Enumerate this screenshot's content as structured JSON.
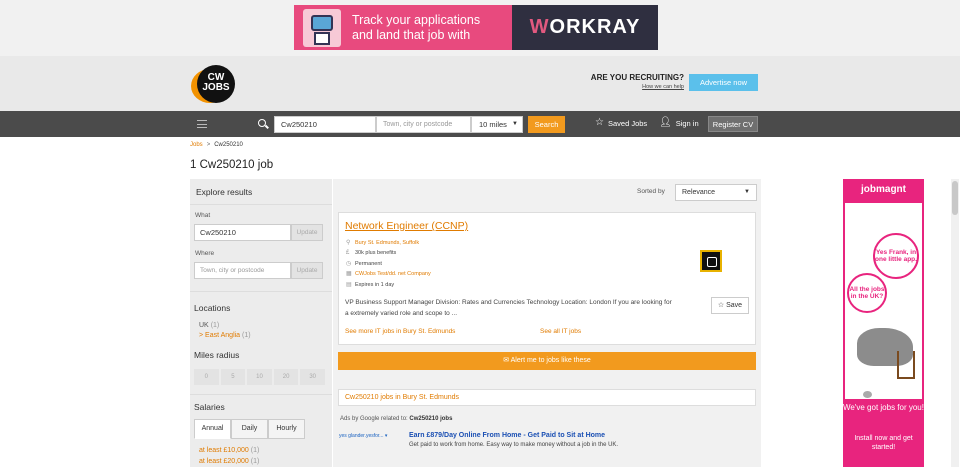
{
  "ad_banner": {
    "text_line1": "Track your applications",
    "text_line2": "and land that job with",
    "brand_part1": "W",
    "brand_part2": "ORKRAY"
  },
  "header": {
    "logo_line1": "CW",
    "logo_line2": "JOBS",
    "recruit_question": "ARE YOU RECRUITING?",
    "recruit_link": "How we can help",
    "advertise_label": "Advertise now"
  },
  "nav": {
    "keyword_value": "Cw250210",
    "location_placeholder": "Town, city or postcode",
    "radius_value": "10 miles",
    "search_label": "Search",
    "saved_jobs_label": "Saved Jobs",
    "signin_label": "Sign in",
    "register_label": "Register CV"
  },
  "breadcrumb": {
    "home": "Jobs",
    "separator": ">",
    "current": "Cw250210"
  },
  "page_title": "1 Cw250210 job",
  "sidebar": {
    "title": "Explore results",
    "what_label": "What",
    "what_value": "Cw250210",
    "where_label": "Where",
    "where_placeholder": "Town, city or postcode",
    "update_label": "Update",
    "locations_heading": "Locations",
    "locations": [
      {
        "name": "UK",
        "count": "(1)"
      },
      {
        "name": "East Anglia",
        "count": "(1)",
        "prefix": ">"
      }
    ],
    "miles_heading": "Miles radius",
    "miles": [
      "0",
      "5",
      "10",
      "20",
      "30"
    ],
    "salaries_heading": "Salaries",
    "salary_tabs": [
      "Annual",
      "Daily",
      "Hourly"
    ],
    "salary_items": [
      {
        "label": "at least £10,000",
        "count": "(1)"
      },
      {
        "label": "at least £20,000",
        "count": "(1)"
      }
    ]
  },
  "main": {
    "sort_label": "Sorted by",
    "sort_value": "Relevance",
    "job": {
      "title": "Network Engineer (CCNP)",
      "location": "Bury St. Edmunds, Suffolk",
      "salary": "30k plus benefits",
      "type": "Permanent",
      "company": "CWJobs Test/dd. net Company",
      "expires": "Expires in 1 day",
      "description": "VP Business Support Manager Division: Rates and Currencies Technology Location: London If you are looking for a extremely varied role and scope to ...",
      "save_label": "Save",
      "more_link": "See more IT jobs in Bury St. Edmunds",
      "all_link": "See all IT jobs"
    },
    "alert_label": "Alert me to jobs like these",
    "related_label": "Cw250210 jobs in Bury St. Edmunds",
    "ads_prefix": "Ads by Google related to:",
    "ads_term": "Cw250210 jobs",
    "gad_source": "yes glander.yesfor...",
    "gad_title": "Earn £879/Day Online From Home - Get Paid to Sit at Home",
    "gad_desc": "Get paid to work from home. Easy way to make money without a job in the UK."
  },
  "side_ad": {
    "brand": "jobmagnt",
    "bubble1": "Yes Frank, in one little app.",
    "bubble2": "All the jobs in the UK?",
    "msg1": "We've got jobs for you!",
    "msg2": "Install now and get started!"
  },
  "colors": {
    "accent": "#f29a1e",
    "link": "#e07b00",
    "nav": "#4b4b4b",
    "ad_pink": "#e8247e",
    "advertise": "#5bc0eb"
  }
}
